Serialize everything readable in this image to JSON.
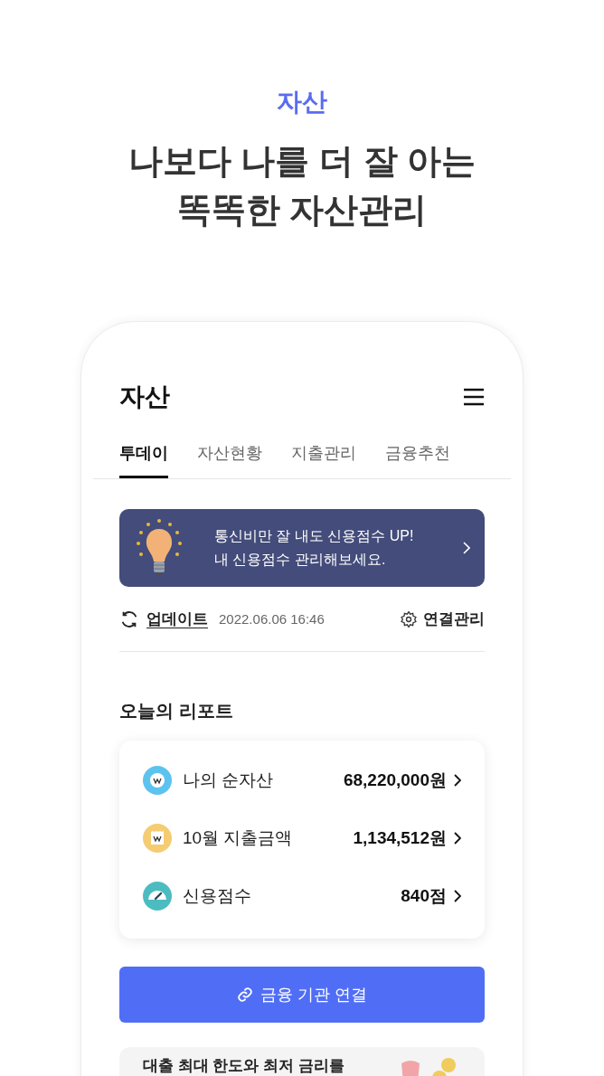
{
  "hero": {
    "label": "자산",
    "headline": [
      "나보다 나를 더 잘 아는",
      "똑똑한 자산관리"
    ]
  },
  "app": {
    "title": "자산"
  },
  "tabs": [
    {
      "label": "투데이",
      "selected": true
    },
    {
      "label": "자산현황",
      "selected": false
    },
    {
      "label": "지출관리",
      "selected": false
    },
    {
      "label": "금융추천",
      "selected": false
    }
  ],
  "banner": {
    "lines": [
      "통신비만 잘 내도 신용점수 UP!",
      "내 신용점수 관리해보세요."
    ]
  },
  "update": {
    "link": "업데이트",
    "timestamp": "2022.06.06 16:46",
    "manage": "연결관리"
  },
  "report": {
    "title": "오늘의 리포트",
    "rows": [
      {
        "kind": "asset",
        "label": "나의 순자산",
        "value": "68,220,000원"
      },
      {
        "kind": "spending",
        "label": "10월 지출금액",
        "value": "1,134,512원"
      },
      {
        "kind": "credit",
        "label": "신용점수",
        "value": "840점"
      }
    ]
  },
  "connect_button": "금융 기관 연결",
  "promo": {
    "text": "대출 최대 한도와 최저 금리를"
  }
}
